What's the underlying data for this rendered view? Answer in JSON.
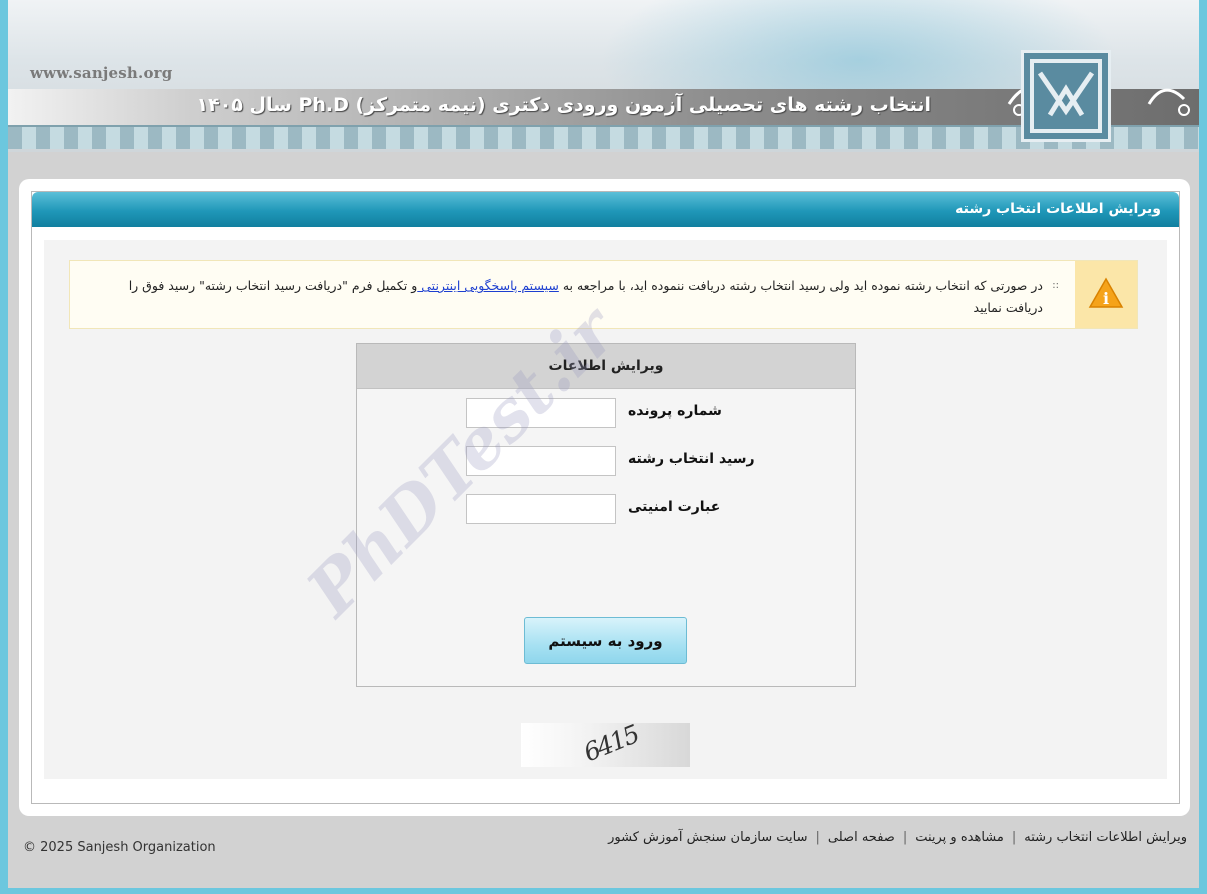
{
  "header": {
    "site_url": "www.sanjesh.org",
    "title": "انتخاب رشته های تحصیلی آزمون ورودی دکتری (نیمه متمرکز) Ph.D سال ۱۴۰۵"
  },
  "panel": {
    "title": "ویرایش اطلاعات انتخاب رشته"
  },
  "alert": {
    "text_before_link": "در صورتی که انتخاب رشته نموده اید ولی رسید انتخاب رشته دریافت ننموده اید، با مراجعه به ",
    "link_text": "سیستم پاسخگویی اینترنتی ",
    "text_after_link": "و تکمیل فرم \"دریافت رسید انتخاب رشته\" رسید فوق را دریافت نمایید",
    "icon": "warning-icon"
  },
  "form": {
    "title": "ویرایش اطلاعات",
    "file_number_label": "شماره پرونده",
    "file_number_value": "",
    "receipt_label": "رسید انتخاب رشته",
    "receipt_value": "",
    "captcha_label": "عبارت امنیتی",
    "captcha_value": "",
    "submit_label": "ورود به سیستم"
  },
  "watermark": "PhDTest.ir",
  "captcha_text": "6415",
  "footer": {
    "links": [
      "ویرایش اطلاعات انتخاب رشته",
      "مشاهده و پرینت",
      "صفحه اصلی",
      "سایت سازمان سنجش آموزش کشور"
    ],
    "copyright": "© 2025 Sanjesh Organization"
  },
  "colors": {
    "header_teal": "#1f97b8",
    "frame_blue": "#6cc7de",
    "alert_bg": "#fffdf3",
    "button_bg": "#a7e1f2"
  }
}
